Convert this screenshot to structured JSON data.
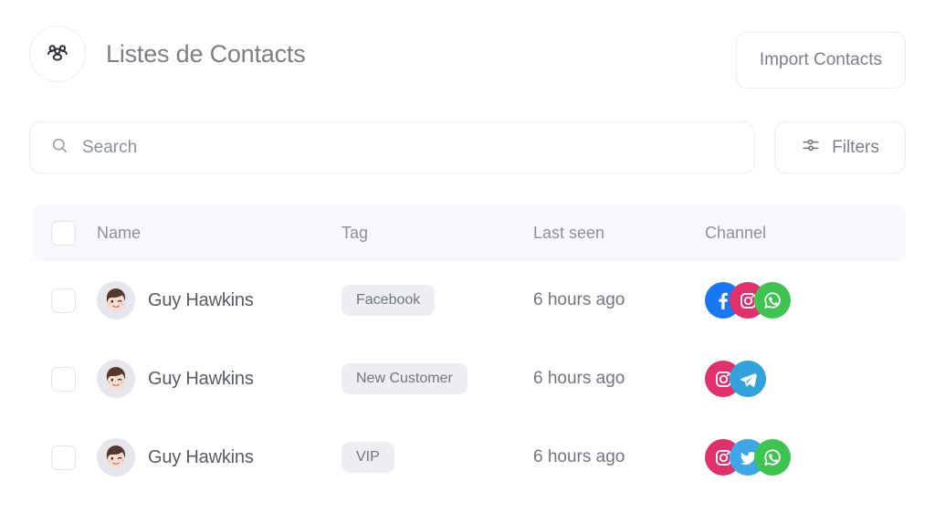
{
  "header": {
    "brand_icon": "users-group-icon",
    "title": "Listes de Contacts",
    "import_button": "Import Contacts"
  },
  "search": {
    "icon": "search-icon",
    "placeholder": "Search",
    "value": ""
  },
  "filters": {
    "icon": "sliders-icon",
    "label": "Filters"
  },
  "table": {
    "columns": {
      "name": "Name",
      "tag": "Tag",
      "last_seen": "Last seen",
      "channel": "Channel"
    },
    "rows": [
      {
        "name": "Guy Hawkins",
        "tag": "Facebook",
        "last_seen": "6 hours ago",
        "channels": [
          "facebook",
          "instagram",
          "whatsapp"
        ]
      },
      {
        "name": "Guy Hawkins",
        "tag": "New Customer",
        "last_seen": "6 hours ago",
        "channels": [
          "instagram",
          "telegram"
        ]
      },
      {
        "name": "Guy Hawkins",
        "tag": "VIP",
        "last_seen": "6 hours ago",
        "channels": [
          "instagram",
          "twitter",
          "whatsapp"
        ]
      }
    ]
  },
  "colors": {
    "facebook": "#1877F2",
    "instagram": "#E1306C",
    "whatsapp": "#3FC351",
    "telegram": "#32A2DC",
    "twitter": "#3EA7E8",
    "header_band": "#f7f8fb",
    "tag_pill": "#eceef1",
    "border": "#ebedf0",
    "text_muted": "#8d9199",
    "text_primary": "#575b63"
  }
}
